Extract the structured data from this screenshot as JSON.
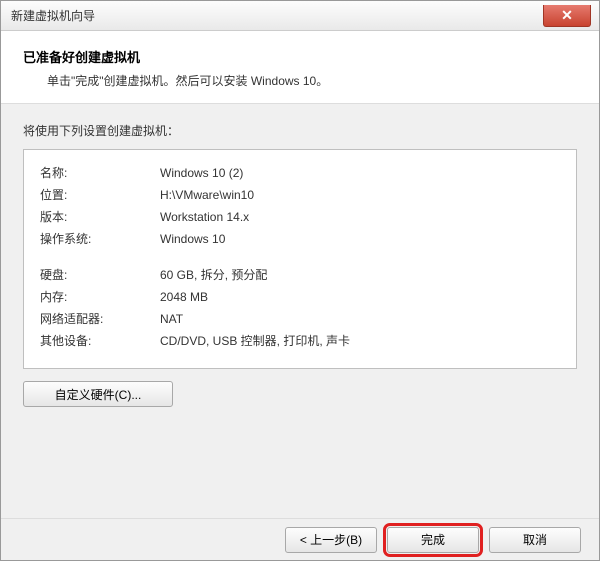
{
  "window": {
    "title": "新建虚拟机向导"
  },
  "header": {
    "title": "已准备好创建虚拟机",
    "subtitle": "单击\"完成\"创建虚拟机。然后可以安装 Windows 10。"
  },
  "body": {
    "intro": "将使用下列设置创建虚拟机：",
    "rows1": [
      {
        "label": "名称:",
        "value": "Windows 10 (2)"
      },
      {
        "label": "位置:",
        "value": "H:\\VMware\\win10"
      },
      {
        "label": "版本:",
        "value": "Workstation 14.x"
      },
      {
        "label": "操作系统:",
        "value": "Windows 10"
      }
    ],
    "rows2": [
      {
        "label": "硬盘:",
        "value": "60 GB, 拆分, 预分配"
      },
      {
        "label": "内存:",
        "value": "2048 MB"
      },
      {
        "label": "网络适配器:",
        "value": "NAT"
      },
      {
        "label": "其他设备:",
        "value": "CD/DVD, USB 控制器, 打印机, 声卡"
      }
    ],
    "customize_button": "自定义硬件(C)..."
  },
  "footer": {
    "back": "< 上一步(B)",
    "finish": "完成",
    "cancel": "取消"
  }
}
